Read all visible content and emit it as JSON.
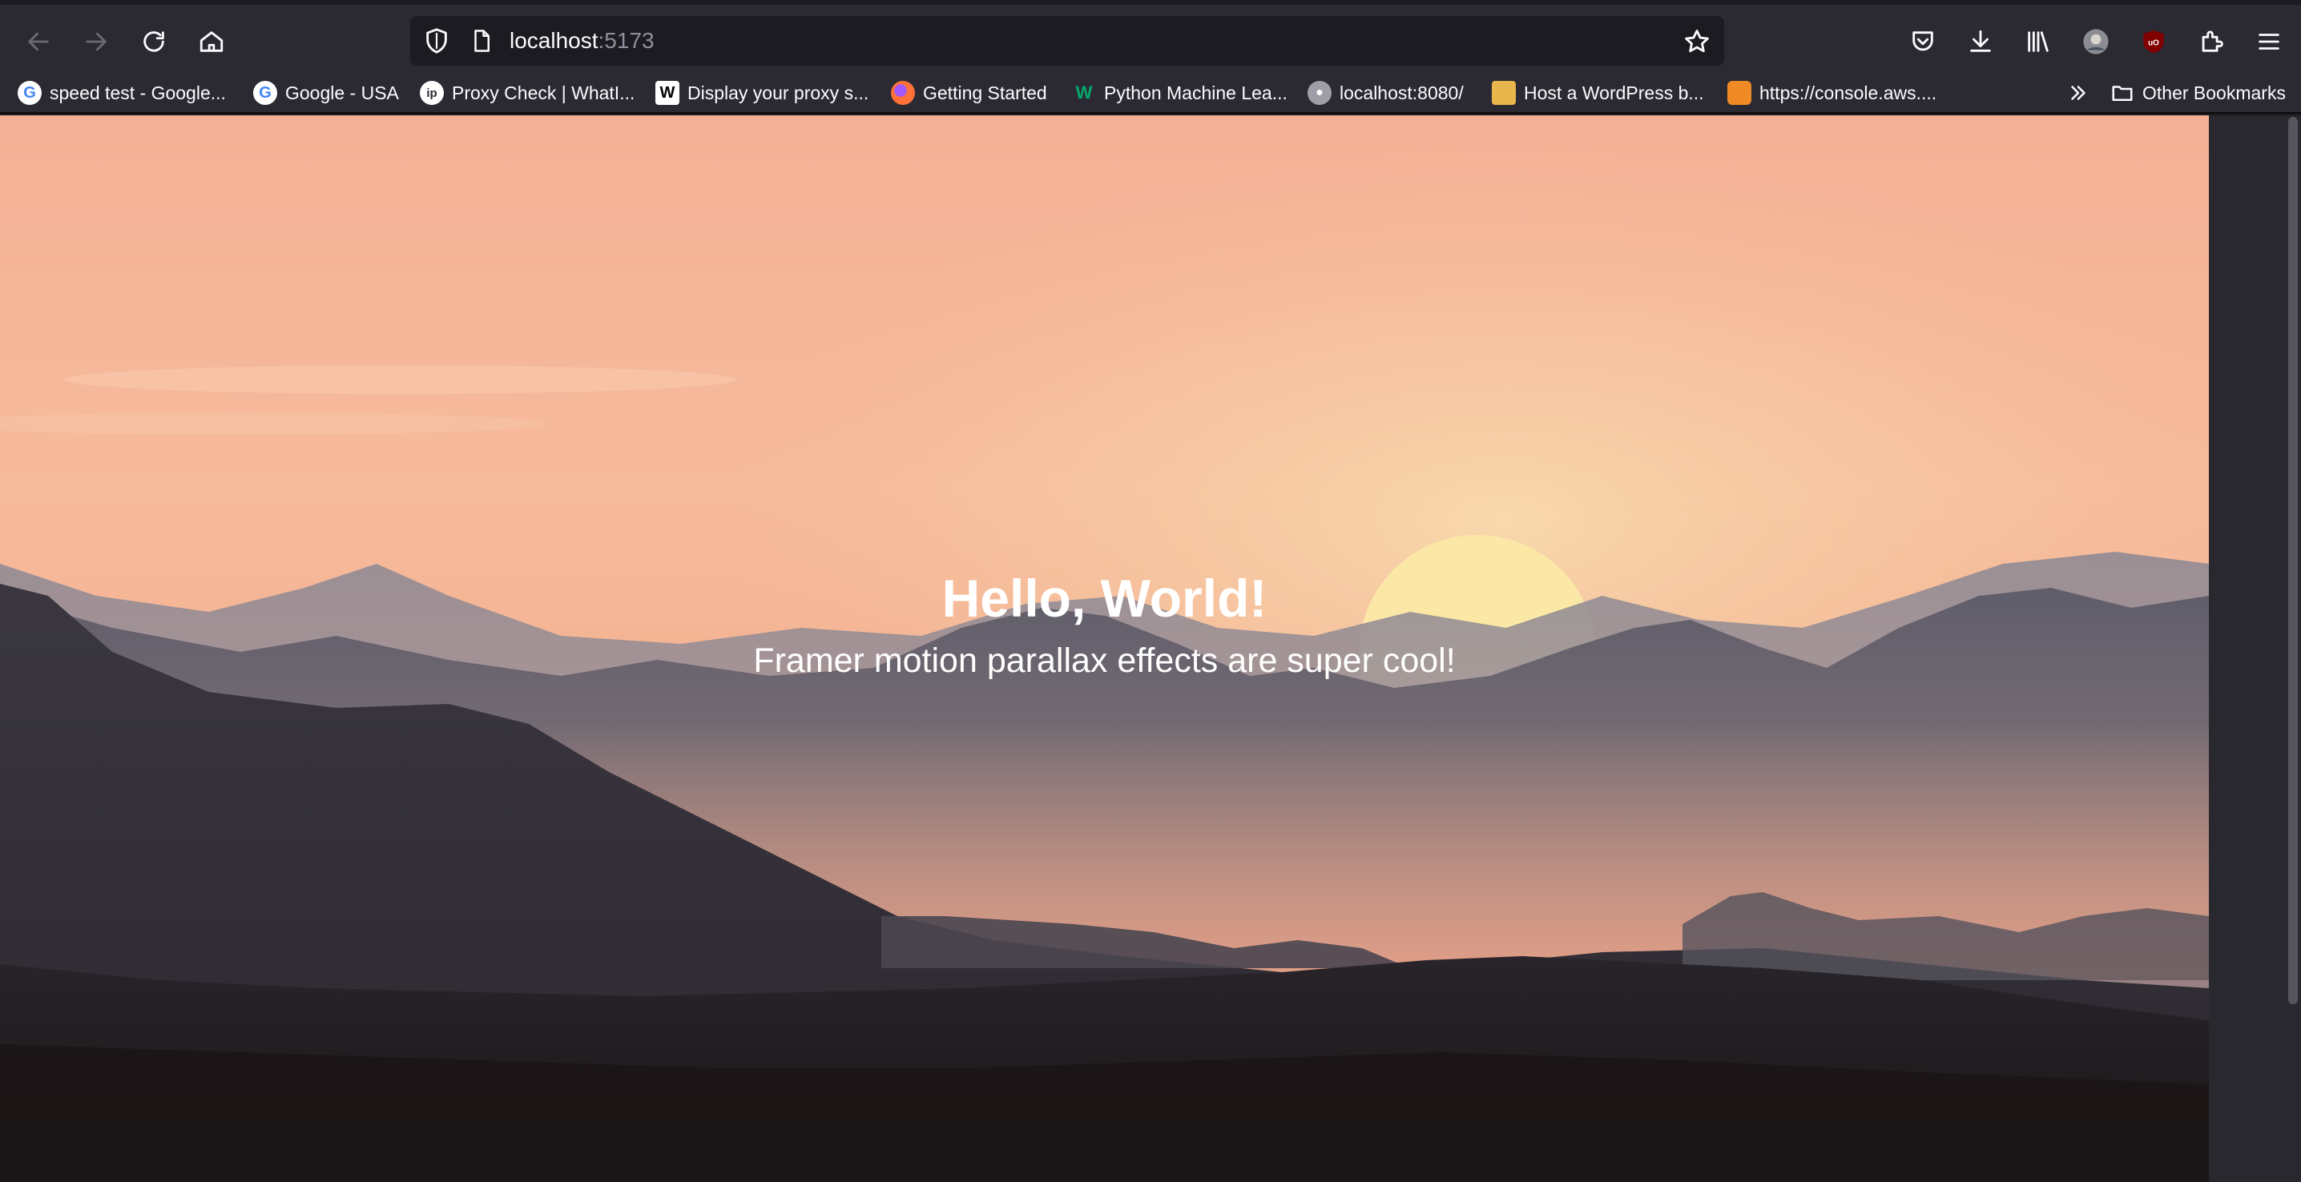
{
  "browser": {
    "url_host": "localhost",
    "url_port": ":5173"
  },
  "toolbar_icons": [
    "back-arrow-icon",
    "forward-arrow-icon",
    "reload-icon",
    "home-icon",
    "shield-icon",
    "page-icon",
    "star-icon",
    "pocket-icon",
    "download-icon",
    "library-icon",
    "account-avatar",
    "ublock-icon",
    "extensions-icon",
    "menu-icon"
  ],
  "bookmarks": [
    {
      "label": "speed test - Google...",
      "icon": "google-icon"
    },
    {
      "label": "Google - USA",
      "icon": "google-icon"
    },
    {
      "label": "Proxy Check | WhatI...",
      "icon": "ip-icon"
    },
    {
      "label": "Display your proxy s...",
      "icon": "w-icon"
    },
    {
      "label": "Getting Started",
      "icon": "firefox-icon"
    },
    {
      "label": "Python Machine Lea...",
      "icon": "w3-icon"
    },
    {
      "label": "localhost:8080/",
      "icon": "elephant-icon"
    },
    {
      "label": "Host a WordPress b...",
      "icon": "box-icon"
    },
    {
      "label": "https://console.aws....",
      "icon": "aws-icon"
    }
  ],
  "other_bookmarks": "Other Bookmarks",
  "page": {
    "title": "Hello, World!",
    "subtitle": "Framer motion parallax effects are super cool!"
  },
  "colors": {
    "sky_top": "#f3b39b",
    "sun": "#fbe8a6",
    "mountain_dark": "#2a2630",
    "toolbar_bg": "#2b2a33"
  }
}
